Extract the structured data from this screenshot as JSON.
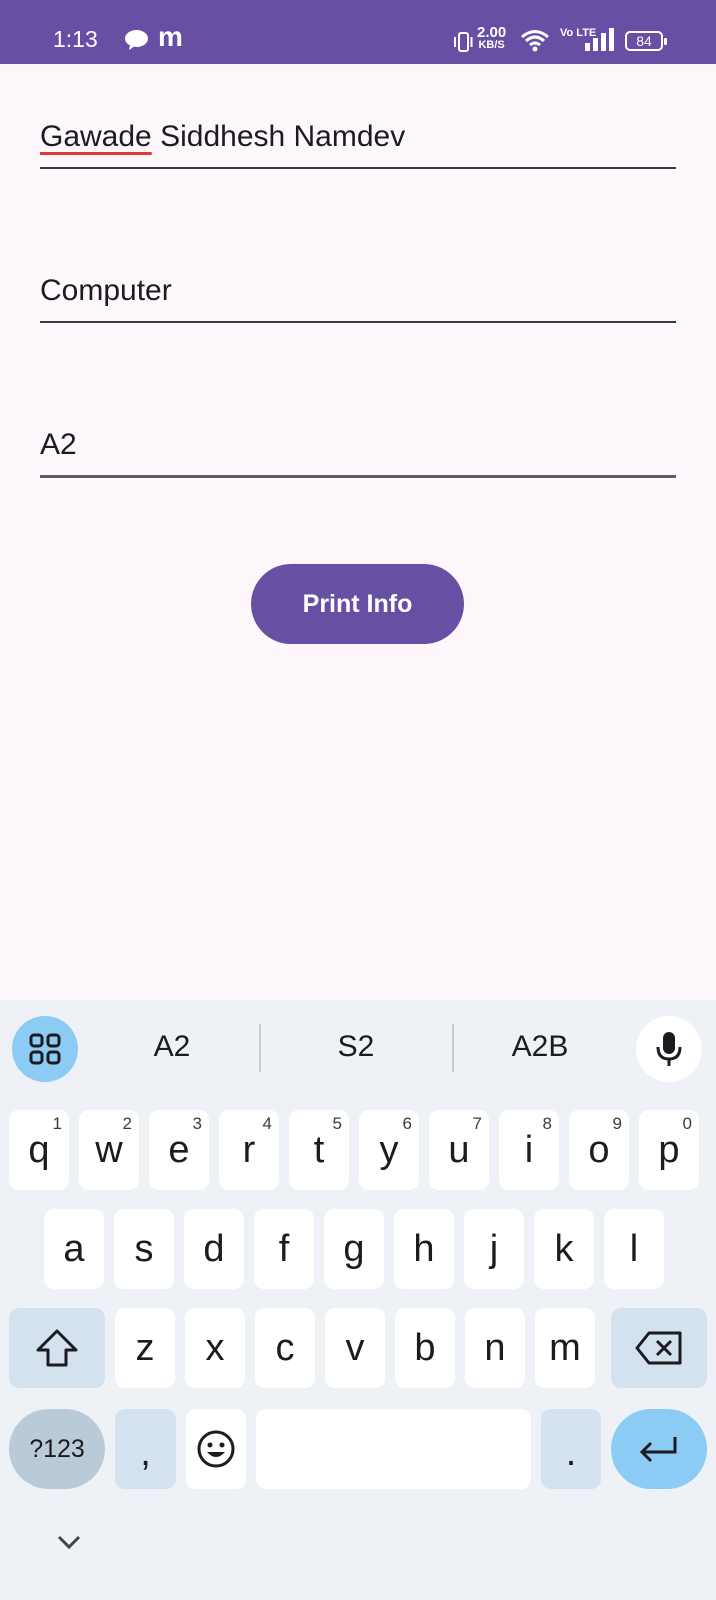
{
  "status_bar": {
    "time": "1:13",
    "m_icon": "m",
    "net_speed": "2.00",
    "net_unit": "KB/S",
    "volte": "Vo LTE",
    "battery": "84"
  },
  "form": {
    "name_value": "Gawade Siddhesh Namdev",
    "name_misspelled_word": "Gawade",
    "name_rest": " Siddhesh Namdev",
    "branch_value": "Computer",
    "division_value": "A2",
    "button_label": "Print Info"
  },
  "keyboard": {
    "suggestions": [
      "A2",
      "S2",
      "A2B"
    ],
    "row1": [
      {
        "k": "q",
        "h": "1"
      },
      {
        "k": "w",
        "h": "2"
      },
      {
        "k": "e",
        "h": "3"
      },
      {
        "k": "r",
        "h": "4"
      },
      {
        "k": "t",
        "h": "5"
      },
      {
        "k": "y",
        "h": "6"
      },
      {
        "k": "u",
        "h": "7"
      },
      {
        "k": "i",
        "h": "8"
      },
      {
        "k": "o",
        "h": "9"
      },
      {
        "k": "p",
        "h": "0"
      }
    ],
    "row2": [
      "a",
      "s",
      "d",
      "f",
      "g",
      "h",
      "j",
      "k",
      "l"
    ],
    "row3": [
      "z",
      "x",
      "c",
      "v",
      "b",
      "n",
      "m"
    ],
    "symbols_label": "?123",
    "comma_label": ",",
    "period_label": "."
  },
  "colors": {
    "primary": "#6750a4",
    "background": "#fef7fb",
    "keyboard_bg": "#eef1f6",
    "accent_blue": "#8ccbf4"
  }
}
